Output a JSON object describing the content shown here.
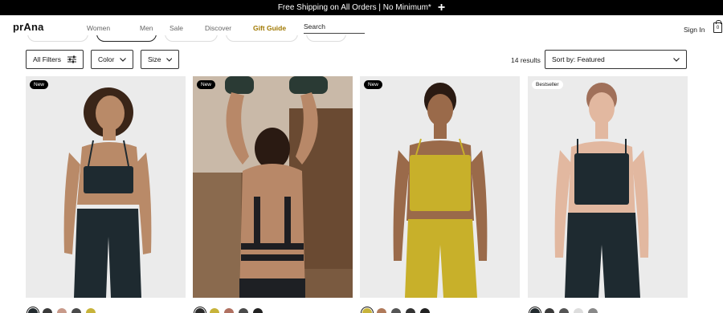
{
  "promo": {
    "text": "Free Shipping on All Orders | No Minimum*",
    "expand_icon": "plus-icon"
  },
  "header": {
    "logo": "prAna",
    "nav": [
      "Women",
      "Men",
      "Sale",
      "Discover",
      "Gift Guide"
    ],
    "search_label": "Search",
    "sign_in": "Sign In",
    "bag_count": "0"
  },
  "filters": {
    "all_filters": "All Filters",
    "color": "Color",
    "size": "Size",
    "results": "14 results",
    "sort": "Sort by: Featured"
  },
  "products": [
    {
      "badge": "New",
      "bg": "#ebebeb",
      "swatches": [
        "#222a2e",
        "#3a3a3a",
        "#c89a8a",
        "#4a4a4a",
        "#c7b33a"
      ]
    },
    {
      "badge": "New",
      "bg": "#8a6a4e",
      "swatches": [
        "#2a2a2a",
        "#c7b33a",
        "#b07060",
        "#4a4a4a",
        "#222"
      ]
    },
    {
      "badge": "New",
      "bg": "#ebebeb",
      "swatches": [
        "#c7b33a",
        "#b07a5a",
        "#555",
        "#333",
        "#222"
      ]
    },
    {
      "badge": "Bestseller",
      "bg": "#ebebeb",
      "swatches": [
        "#222a2e",
        "#3a3a3a",
        "#555",
        "#ddd",
        "#888"
      ]
    }
  ]
}
